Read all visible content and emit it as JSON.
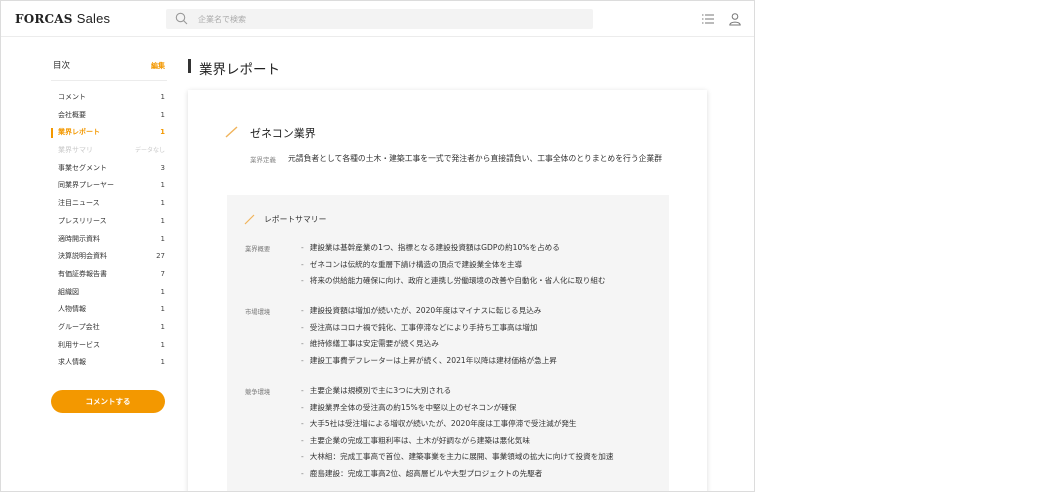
{
  "header": {
    "logo_bold": "FORCAS",
    "logo_suffix": "Sales",
    "search_placeholder": "企業名で検索"
  },
  "icons": {
    "search": "search-icon",
    "list": "list-icon",
    "user": "user-icon",
    "slash": "slash-mark-icon"
  },
  "colors": {
    "accent": "#f39800",
    "text": "#333333",
    "summary_bg": "#f5f5f5"
  },
  "toc": {
    "title": "目次",
    "edit_label": "編集",
    "items": [
      {
        "label": "コメント",
        "count": "1"
      },
      {
        "label": "会社概要",
        "count": "1"
      },
      {
        "label": "業界レポート",
        "count": "1",
        "active": true
      },
      {
        "label": "業界サマリ",
        "count": "データなし",
        "muted": true
      },
      {
        "label": "事業セグメント",
        "count": "3"
      },
      {
        "label": "同業界プレーヤー",
        "count": "1"
      },
      {
        "label": "注目ニュース",
        "count": "1"
      },
      {
        "label": "プレスリリース",
        "count": "1"
      },
      {
        "label": "適時開示資料",
        "count": "1"
      },
      {
        "label": "決算説明会資料",
        "count": "27"
      },
      {
        "label": "有価証券報告書",
        "count": "7"
      },
      {
        "label": "組織図",
        "count": "1"
      },
      {
        "label": "人物情報",
        "count": "1"
      },
      {
        "label": "グループ会社",
        "count": "1"
      },
      {
        "label": "利用サービス",
        "count": "1"
      },
      {
        "label": "求人情報",
        "count": "1"
      }
    ],
    "comment_button": "コメントする"
  },
  "main": {
    "page_title": "業界レポート",
    "industry_name": "ゼネコン業界",
    "definition_label": "業界定義",
    "definition_text": "元請負者として各種の土木・建築工事を一式で発注者から直接請負い、工事全体のとりまとめを行う企業群",
    "summary_title": "レポートサマリー",
    "sections": [
      {
        "label": "業界概要",
        "bullets": [
          "建設業は基幹産業の1つ、指標となる建設投資額はGDPの約10%を占める",
          "ゼネコンは伝統的な重層下請け構造の頂点で建設業全体を主導",
          "将来の供給能力確保に向け、政府と連携し労働環境の改善や自動化・省人化に取り組む"
        ]
      },
      {
        "label": "市場環境",
        "bullets": [
          "建設投資額は増加が続いたが、2020年度はマイナスに転じる見込み",
          "受注高はコロナ禍で鈍化、工事停滞などにより手持ち工事高は増加",
          "維持修繕工事は安定需要が続く見込み",
          "建設工事費デフレーターは上昇が続く、2021年以降は建材価格が急上昇"
        ]
      },
      {
        "label": "競争環境",
        "bullets": [
          "主要企業は規模別で主に3つに大別される",
          "建設業界全体の受注高の約15%を中堅以上のゼネコンが確保",
          "大手5社は受注増による増収が続いたが、2020年度は工事停滞で受注減が発生",
          "主要企業の完成工事粗利率は、土木が好調ながら建築は悪化気味",
          "大林組：完成工事高で首位、建築事業を主力に展開、事業領域の拡大に向けて投資を加速",
          "鹿島建設：完成工事高2位、超高層ビルや大型プロジェクトの先駆者"
        ]
      }
    ]
  }
}
